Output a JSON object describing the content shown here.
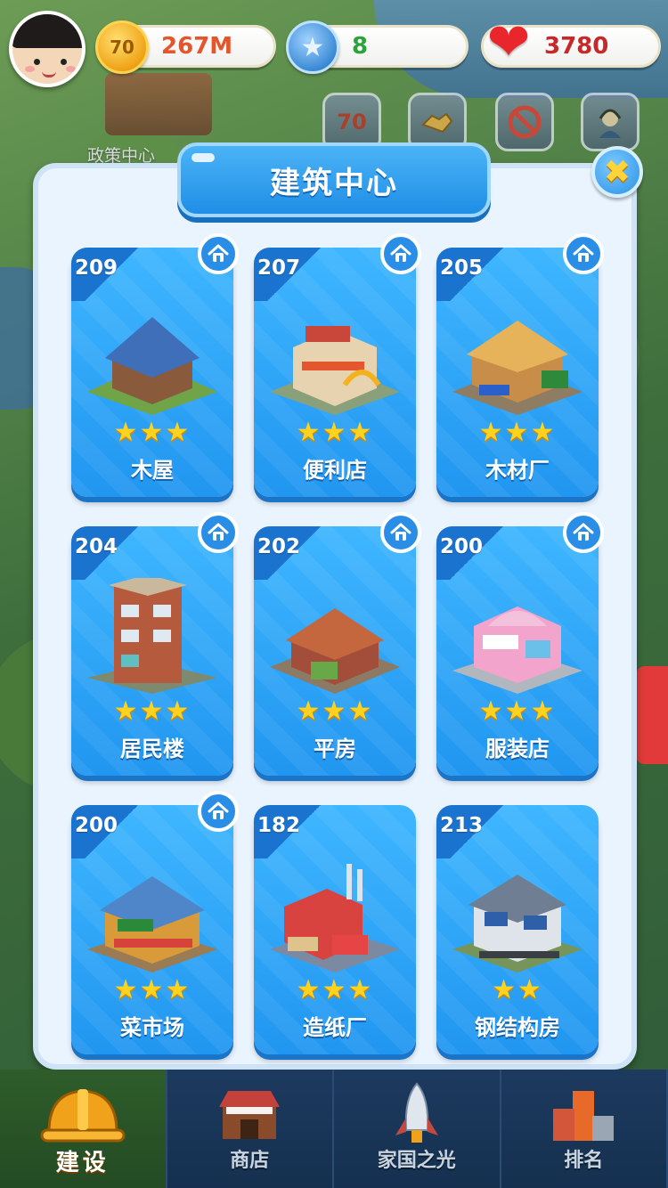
{
  "hud": {
    "coins": "267M",
    "stars": "8",
    "hearts": "3780",
    "coin_icon_text": "70",
    "star_icon_text": "★",
    "heart_icon_text": "❤"
  },
  "background": {
    "policy_center_label": "政策中心",
    "quick_btn_1_text": "70"
  },
  "modal": {
    "title": "建筑中心",
    "close_label": "✖"
  },
  "buildings": [
    {
      "level": "209",
      "stars": "★★★",
      "name": "木屋",
      "home": true
    },
    {
      "level": "207",
      "stars": "★★★",
      "name": "便利店",
      "home": true
    },
    {
      "level": "205",
      "stars": "★★★",
      "name": "木材厂",
      "home": true
    },
    {
      "level": "204",
      "stars": "★★★",
      "name": "居民楼",
      "home": true
    },
    {
      "level": "202",
      "stars": "★★★",
      "name": "平房",
      "home": true
    },
    {
      "level": "200",
      "stars": "★★★",
      "name": "服装店",
      "home": true
    },
    {
      "level": "200",
      "stars": "★★★",
      "name": "菜市场",
      "home": true
    },
    {
      "level": "182",
      "stars": "★★★",
      "name": "造纸厂",
      "home": false
    },
    {
      "level": "213",
      "stars": "★★",
      "name": "钢结构房",
      "home": false
    }
  ],
  "nav": [
    {
      "label": "建设",
      "active": true
    },
    {
      "label": "商店",
      "active": false
    },
    {
      "label": "家国之光",
      "active": false
    },
    {
      "label": "排名",
      "active": false
    }
  ],
  "colors": {
    "card_blue": "#2196f0",
    "coin_text": "#e5542a",
    "star_text": "#2aa43a",
    "heart_text": "#c8282a"
  }
}
